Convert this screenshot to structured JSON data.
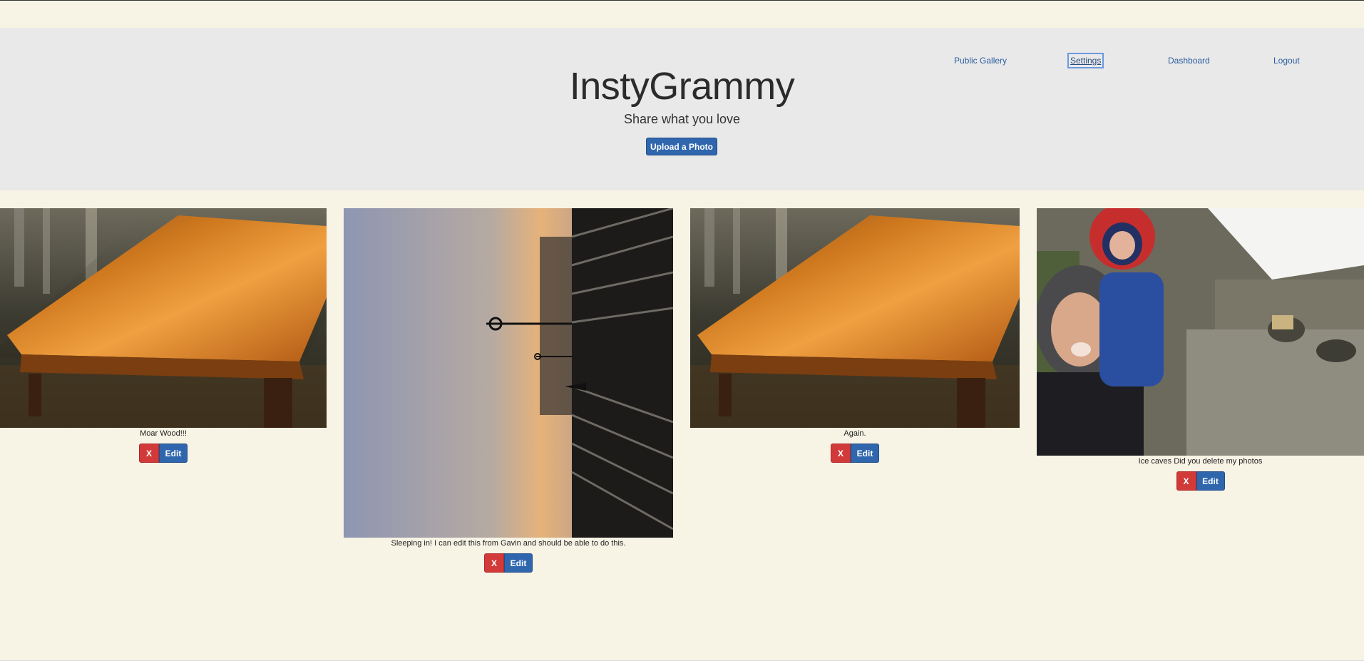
{
  "nav": {
    "public_gallery": "Public Gallery",
    "settings": "Settings",
    "dashboard": "Dashboard",
    "logout": "Logout"
  },
  "header": {
    "title": "InstyGrammy",
    "tagline": "Share what you love",
    "upload_label": "Upload a Photo"
  },
  "photos": [
    {
      "caption": "Moar Wood!!!",
      "delete_label": "X",
      "edit_label": "Edit",
      "subject": "wooden table"
    },
    {
      "caption": "Sleeping in!  I can edit this from Gavin and should be able to do this.",
      "delete_label": "X",
      "edit_label": "Edit",
      "subject": "pier at sunset (rotated)"
    },
    {
      "caption": "Again.",
      "delete_label": "X",
      "edit_label": "Edit",
      "subject": "wooden table"
    },
    {
      "caption": "Ice caves Did you delete my photos",
      "delete_label": "X",
      "edit_label": "Edit",
      "subject": "mother and child at ice caves"
    }
  ],
  "colors": {
    "page_bg": "#f7f3e5",
    "header_bg": "#e9e9e9",
    "primary": "#2f66ad",
    "danger": "#d23a3a"
  }
}
